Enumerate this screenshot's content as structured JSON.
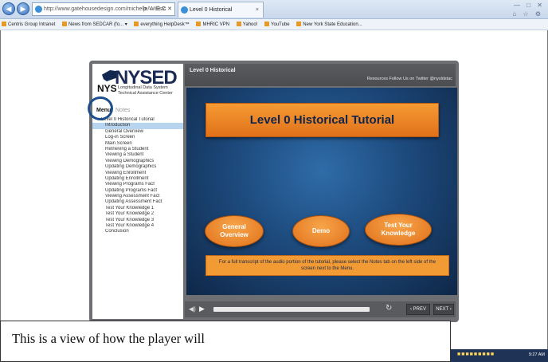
{
  "browser": {
    "url": "http://www.gatehousedesign.com/michelle/Wd/stc",
    "addr_controls": "ρ → ☰ C ✕",
    "tab_title": "Level 0 Historical",
    "tab_close": "×",
    "window_controls": "— □ ✕",
    "window_icons": "⌂ ☆ ⚙",
    "favorites": [
      "Centris Group Intranet",
      "News from SEDCAR (fo... ▾",
      "everything HelpDesk™",
      "MHRIC VPN",
      "Yahoo!",
      "YouTube",
      "New York State Education..."
    ]
  },
  "player": {
    "logo": {
      "main": "NYSED",
      "prefix": "NYS",
      "subtitle": "Longitudinal Data System Technical Assistance Center"
    },
    "side_tabs": {
      "menu": "Menu",
      "notes": "Notes"
    },
    "menu_items": [
      "▾  Level 0 Historical Tutorial",
      "Introduction",
      "General Overview",
      "Log-in Screen",
      "Main Screen",
      "Retrieving a Student",
      "Viewing a Student",
      "Viewing Demographics",
      "Updating Demographics",
      "Viewing Enrollment",
      "Updating Enrollment",
      "Viewing Programs Fact",
      "Updating Programs Fact",
      "Viewing Assessment Fact",
      "Updating Assessment Fact",
      "Test Your Knowledge 1",
      "Test Your Knowledge 2",
      "Test Your Knowledge 3",
      "Test Your Knowledge 4",
      "Conclusion"
    ],
    "header_title": "Level 0 Historical",
    "header_links": "Resources   Follow Us on Twitter @nysldstac",
    "slide": {
      "banner": "Level 0 Historical Tutorial",
      "buttons": [
        "General Overview",
        "Demo",
        "Test Your Knowledge"
      ],
      "note": "For a full transcript of the audio portion of the tutorial, please select the Notes tab on the left side of the screen next to the Menu."
    },
    "controls": {
      "volume": "◀)",
      "play": "▶",
      "replay": "↻",
      "prev": "‹ PREV",
      "next": "NEXT ›"
    }
  },
  "caption": "This is a view of how the player will",
  "taskbar": {
    "icons": "■■■■■■■■■",
    "time": "9:27 AM"
  }
}
